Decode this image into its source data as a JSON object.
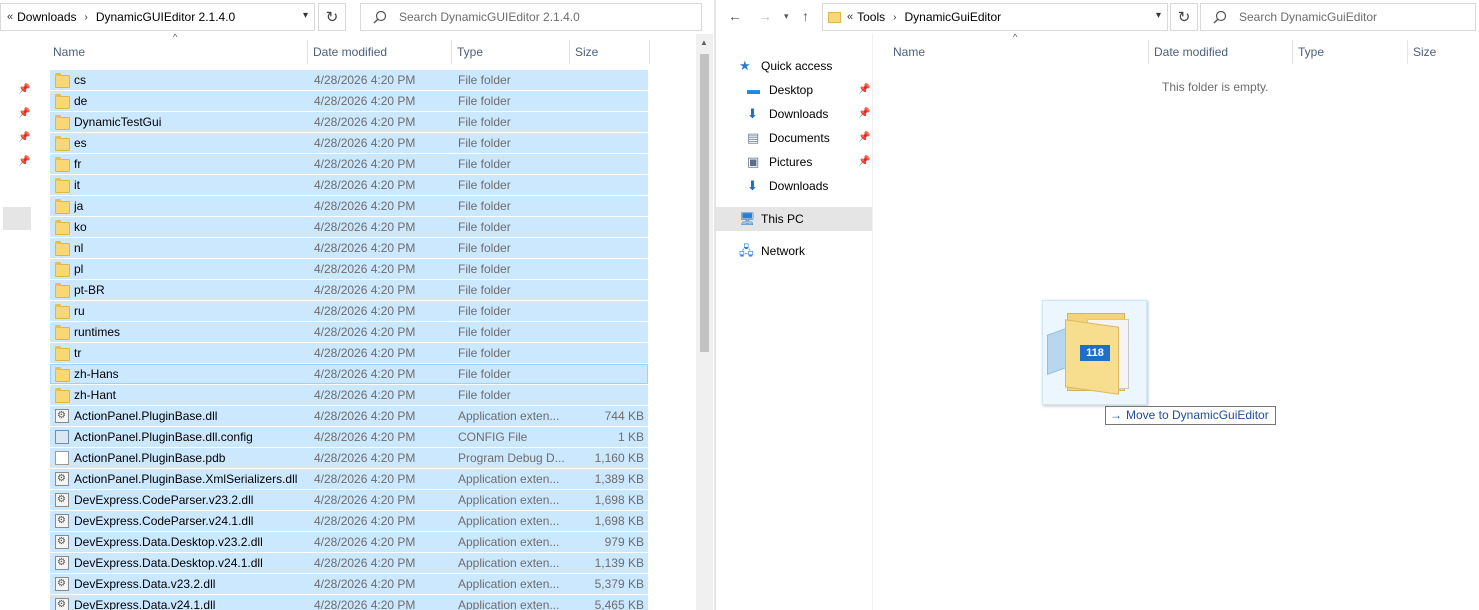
{
  "left": {
    "breadcrumb_chevron": "«",
    "breadcrumb": [
      "Downloads",
      "DynamicGUIEditor 2.1.4.0"
    ],
    "search_placeholder": "Search DynamicGUIEditor 2.1.4.0",
    "columns": [
      "Name",
      "Date modified",
      "Type",
      "Size"
    ],
    "rows": [
      {
        "name": "cs",
        "date": "4/28/2026 4:20 PM",
        "type": "File folder",
        "size": "",
        "icon": "folder-icon"
      },
      {
        "name": "de",
        "date": "4/28/2026 4:20 PM",
        "type": "File folder",
        "size": "",
        "icon": "folder-icon"
      },
      {
        "name": "DynamicTestGui",
        "date": "4/28/2026 4:20 PM",
        "type": "File folder",
        "size": "",
        "icon": "folder-icon"
      },
      {
        "name": "es",
        "date": "4/28/2026 4:20 PM",
        "type": "File folder",
        "size": "",
        "icon": "folder-icon"
      },
      {
        "name": "fr",
        "date": "4/28/2026 4:20 PM",
        "type": "File folder",
        "size": "",
        "icon": "folder-icon"
      },
      {
        "name": "it",
        "date": "4/28/2026 4:20 PM",
        "type": "File folder",
        "size": "",
        "icon": "folder-icon"
      },
      {
        "name": "ja",
        "date": "4/28/2026 4:20 PM",
        "type": "File folder",
        "size": "",
        "icon": "folder-icon"
      },
      {
        "name": "ko",
        "date": "4/28/2026 4:20 PM",
        "type": "File folder",
        "size": "",
        "icon": "folder-icon"
      },
      {
        "name": "nl",
        "date": "4/28/2026 4:20 PM",
        "type": "File folder",
        "size": "",
        "icon": "folder-icon"
      },
      {
        "name": "pl",
        "date": "4/28/2026 4:20 PM",
        "type": "File folder",
        "size": "",
        "icon": "folder-icon"
      },
      {
        "name": "pt-BR",
        "date": "4/28/2026 4:20 PM",
        "type": "File folder",
        "size": "",
        "icon": "folder-icon"
      },
      {
        "name": "ru",
        "date": "4/28/2026 4:20 PM",
        "type": "File folder",
        "size": "",
        "icon": "folder-icon"
      },
      {
        "name": "runtimes",
        "date": "4/28/2026 4:20 PM",
        "type": "File folder",
        "size": "",
        "icon": "folder-icon"
      },
      {
        "name": "tr",
        "date": "4/28/2026 4:20 PM",
        "type": "File folder",
        "size": "",
        "icon": "folder-icon"
      },
      {
        "name": "zh-Hans",
        "date": "4/28/2026 4:20 PM",
        "type": "File folder",
        "size": "",
        "icon": "folder-icon"
      },
      {
        "name": "zh-Hant",
        "date": "4/28/2026 4:20 PM",
        "type": "File folder",
        "size": "",
        "icon": "folder-icon"
      },
      {
        "name": "ActionPanel.PluginBase.dll",
        "date": "4/28/2026 4:20 PM",
        "type": "Application exten...",
        "size": "744 KB",
        "icon": "dll-icon"
      },
      {
        "name": "ActionPanel.PluginBase.dll.config",
        "date": "4/28/2026 4:20 PM",
        "type": "CONFIG File",
        "size": "1 KB",
        "icon": "config-file-icon"
      },
      {
        "name": "ActionPanel.PluginBase.pdb",
        "date": "4/28/2026 4:20 PM",
        "type": "Program Debug D...",
        "size": "1,160 KB",
        "icon": "pdb-file-icon"
      },
      {
        "name": "ActionPanel.PluginBase.XmlSerializers.dll",
        "date": "4/28/2026 4:20 PM",
        "type": "Application exten...",
        "size": "1,389 KB",
        "icon": "dll-icon"
      },
      {
        "name": "DevExpress.CodeParser.v23.2.dll",
        "date": "4/28/2026 4:20 PM",
        "type": "Application exten...",
        "size": "1,698 KB",
        "icon": "dll-icon"
      },
      {
        "name": "DevExpress.CodeParser.v24.1.dll",
        "date": "4/28/2026 4:20 PM",
        "type": "Application exten...",
        "size": "1,698 KB",
        "icon": "dll-icon"
      },
      {
        "name": "DevExpress.Data.Desktop.v23.2.dll",
        "date": "4/28/2026 4:20 PM",
        "type": "Application exten...",
        "size": "979 KB",
        "icon": "dll-icon"
      },
      {
        "name": "DevExpress.Data.Desktop.v24.1.dll",
        "date": "4/28/2026 4:20 PM",
        "type": "Application exten...",
        "size": "1,139 KB",
        "icon": "dll-icon"
      },
      {
        "name": "DevExpress.Data.v23.2.dll",
        "date": "4/28/2026 4:20 PM",
        "type": "Application exten...",
        "size": "5,379 KB",
        "icon": "dll-icon"
      },
      {
        "name": "DevExpress.Data.v24.1.dll",
        "date": "4/28/2026 4:20 PM",
        "type": "Application exten...",
        "size": "5,465 KB",
        "icon": "dll-icon"
      }
    ]
  },
  "right": {
    "breadcrumb_chevron": "«",
    "breadcrumb": [
      "Tools",
      "DynamicGuiEditor"
    ],
    "search_placeholder": "Search DynamicGuiEditor",
    "columns": [
      "Name",
      "Date modified",
      "Type",
      "Size"
    ],
    "empty_message": "This folder is empty.",
    "nav": [
      {
        "label": "Quick access",
        "icon": "star-icon",
        "pinned": false
      },
      {
        "label": "Desktop",
        "icon": "desktop-icon",
        "pinned": true
      },
      {
        "label": "Downloads",
        "icon": "download-arrow-icon",
        "pinned": true
      },
      {
        "label": "Documents",
        "icon": "documents-icon",
        "pinned": true
      },
      {
        "label": "Pictures",
        "icon": "pictures-icon",
        "pinned": true
      },
      {
        "label": "Downloads",
        "icon": "download-arrow-icon",
        "pinned": false
      },
      {
        "label": "This PC",
        "icon": "computer-icon",
        "pinned": false
      },
      {
        "label": "Network",
        "icon": "network-icon",
        "pinned": false
      }
    ]
  },
  "drag": {
    "count": "118",
    "tooltip": "Move to DynamicGuiEditor",
    "tooltip_arrow": "→"
  },
  "colors": {
    "selection": "#cce8ff",
    "selection_border": "#99d1ff",
    "badge": "#1f6fc5",
    "header_text": "#4c607a"
  }
}
